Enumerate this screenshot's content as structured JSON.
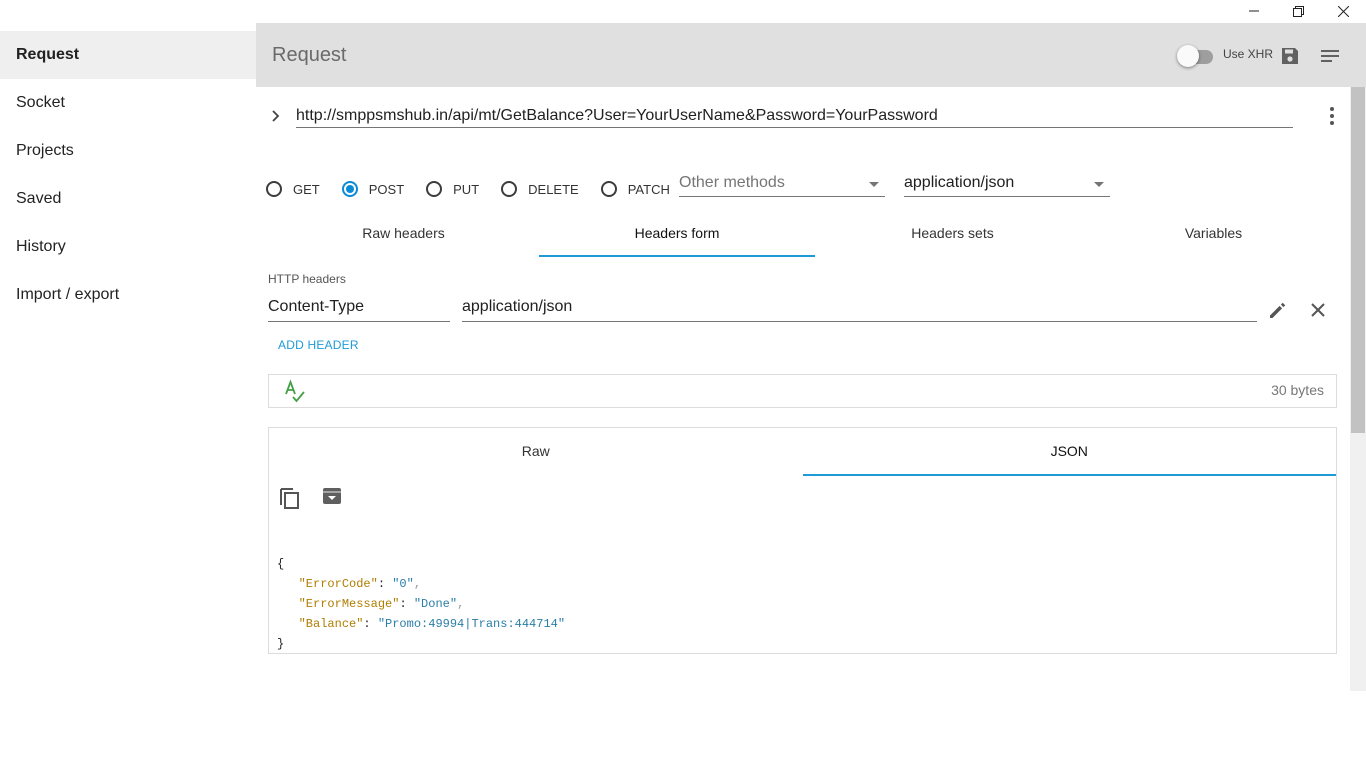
{
  "window_controls": {
    "minimize": "minimize",
    "restore": "restore",
    "close": "close"
  },
  "sidebar": {
    "items": [
      {
        "label": "Request",
        "active": true
      },
      {
        "label": "Socket"
      },
      {
        "label": "Projects"
      },
      {
        "label": "Saved"
      },
      {
        "label": "History"
      },
      {
        "label": "Import / export"
      }
    ]
  },
  "header": {
    "title": "Request",
    "use_xhr_label": "Use XHR",
    "use_xhr_enabled": false
  },
  "request": {
    "url": "http://smppsmshub.in/api/mt/GetBalance?User=YourUserName&Password=YourPassword",
    "methods": [
      {
        "label": "GET",
        "checked": false
      },
      {
        "label": "POST",
        "checked": true
      },
      {
        "label": "PUT",
        "checked": false
      },
      {
        "label": "DELETE",
        "checked": false
      },
      {
        "label": "PATCH",
        "checked": false
      }
    ],
    "other_methods_placeholder": "Other methods",
    "content_type": "application/json"
  },
  "header_tabs": [
    {
      "label": "Raw headers",
      "active": false
    },
    {
      "label": "Headers form",
      "active": true
    },
    {
      "label": "Headers sets",
      "active": false
    },
    {
      "label": "Variables",
      "active": false
    }
  ],
  "headers_form": {
    "section_label": "HTTP headers",
    "rows": [
      {
        "name": "Content-Type",
        "value": "application/json"
      }
    ],
    "add_header_label": "ADD HEADER"
  },
  "body_editor": {
    "size": "30 bytes"
  },
  "response": {
    "tabs": [
      {
        "label": "Raw",
        "active": false
      },
      {
        "label": "JSON",
        "active": true
      }
    ],
    "json": {
      "open": "{",
      "close": "}",
      "entries": [
        {
          "key": "\"ErrorCode\"",
          "value": "\"0\"",
          "comma": ","
        },
        {
          "key": "\"ErrorMessage\"",
          "value": "\"Done\"",
          "comma": ","
        },
        {
          "key": "\"Balance\"",
          "value": "\"Promo:49994|Trans:444714\"",
          "comma": ""
        }
      ]
    }
  },
  "colors": {
    "accent": "#1e9bd7",
    "radio_checked": "#0a8bd6",
    "header_bg": "#e0e0e0",
    "json_key": "#b07d00",
    "json_string": "#2a7ea8"
  },
  "icons": [
    "minimize-icon",
    "restore-icon",
    "close-icon",
    "save-icon",
    "sort-icon",
    "chevron-right-icon",
    "more-vert-icon",
    "pencil-icon",
    "close-icon",
    "spellcheck-icon",
    "copy-icon",
    "archive-icon"
  ]
}
